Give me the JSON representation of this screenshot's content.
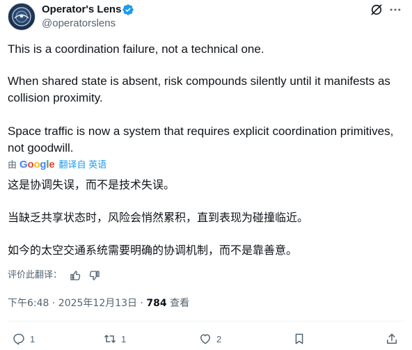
{
  "author": {
    "display_name": "Operator's Lens",
    "handle": "@operatorslens",
    "verified": true
  },
  "icons": {
    "top_right": [
      "grok-icon",
      "more-icon"
    ],
    "actions": [
      "reply-icon",
      "retweet-icon",
      "like-icon",
      "bookmark-icon",
      "share-icon"
    ],
    "rating": [
      "thumbs-up-icon",
      "thumbs-down-icon"
    ]
  },
  "tweet": {
    "paragraphs": [
      "This is a coordination failure, not a technical one.",
      "When shared state is absent, risk compounds silently until it manifests as collision proximity.",
      "Space traffic is now a system that requires explicit coordination primitives, not goodwill."
    ]
  },
  "translation": {
    "by_label": "由",
    "provider": "Google",
    "translated_from": "翻译自 英语",
    "paragraphs": [
      "这是协调失误，而不是技术失误。",
      "当缺乏共享状态时，风险会悄然累积，直到表现为碰撞临近。",
      "如今的太空交通系统需要明确的协调机制，而不是靠善意。"
    ],
    "rate_label": "评价此翻译："
  },
  "meta": {
    "timestamp": "下午6:48 · 2025年12月13日 · ",
    "views_count": "784",
    "views_label": " 查看"
  },
  "actions": {
    "reply_count": "1",
    "retweet_count": "1",
    "like_count": "2"
  },
  "colors": {
    "text": "#0f1419",
    "secondary": "#536471",
    "accent": "#1d9bf0"
  }
}
